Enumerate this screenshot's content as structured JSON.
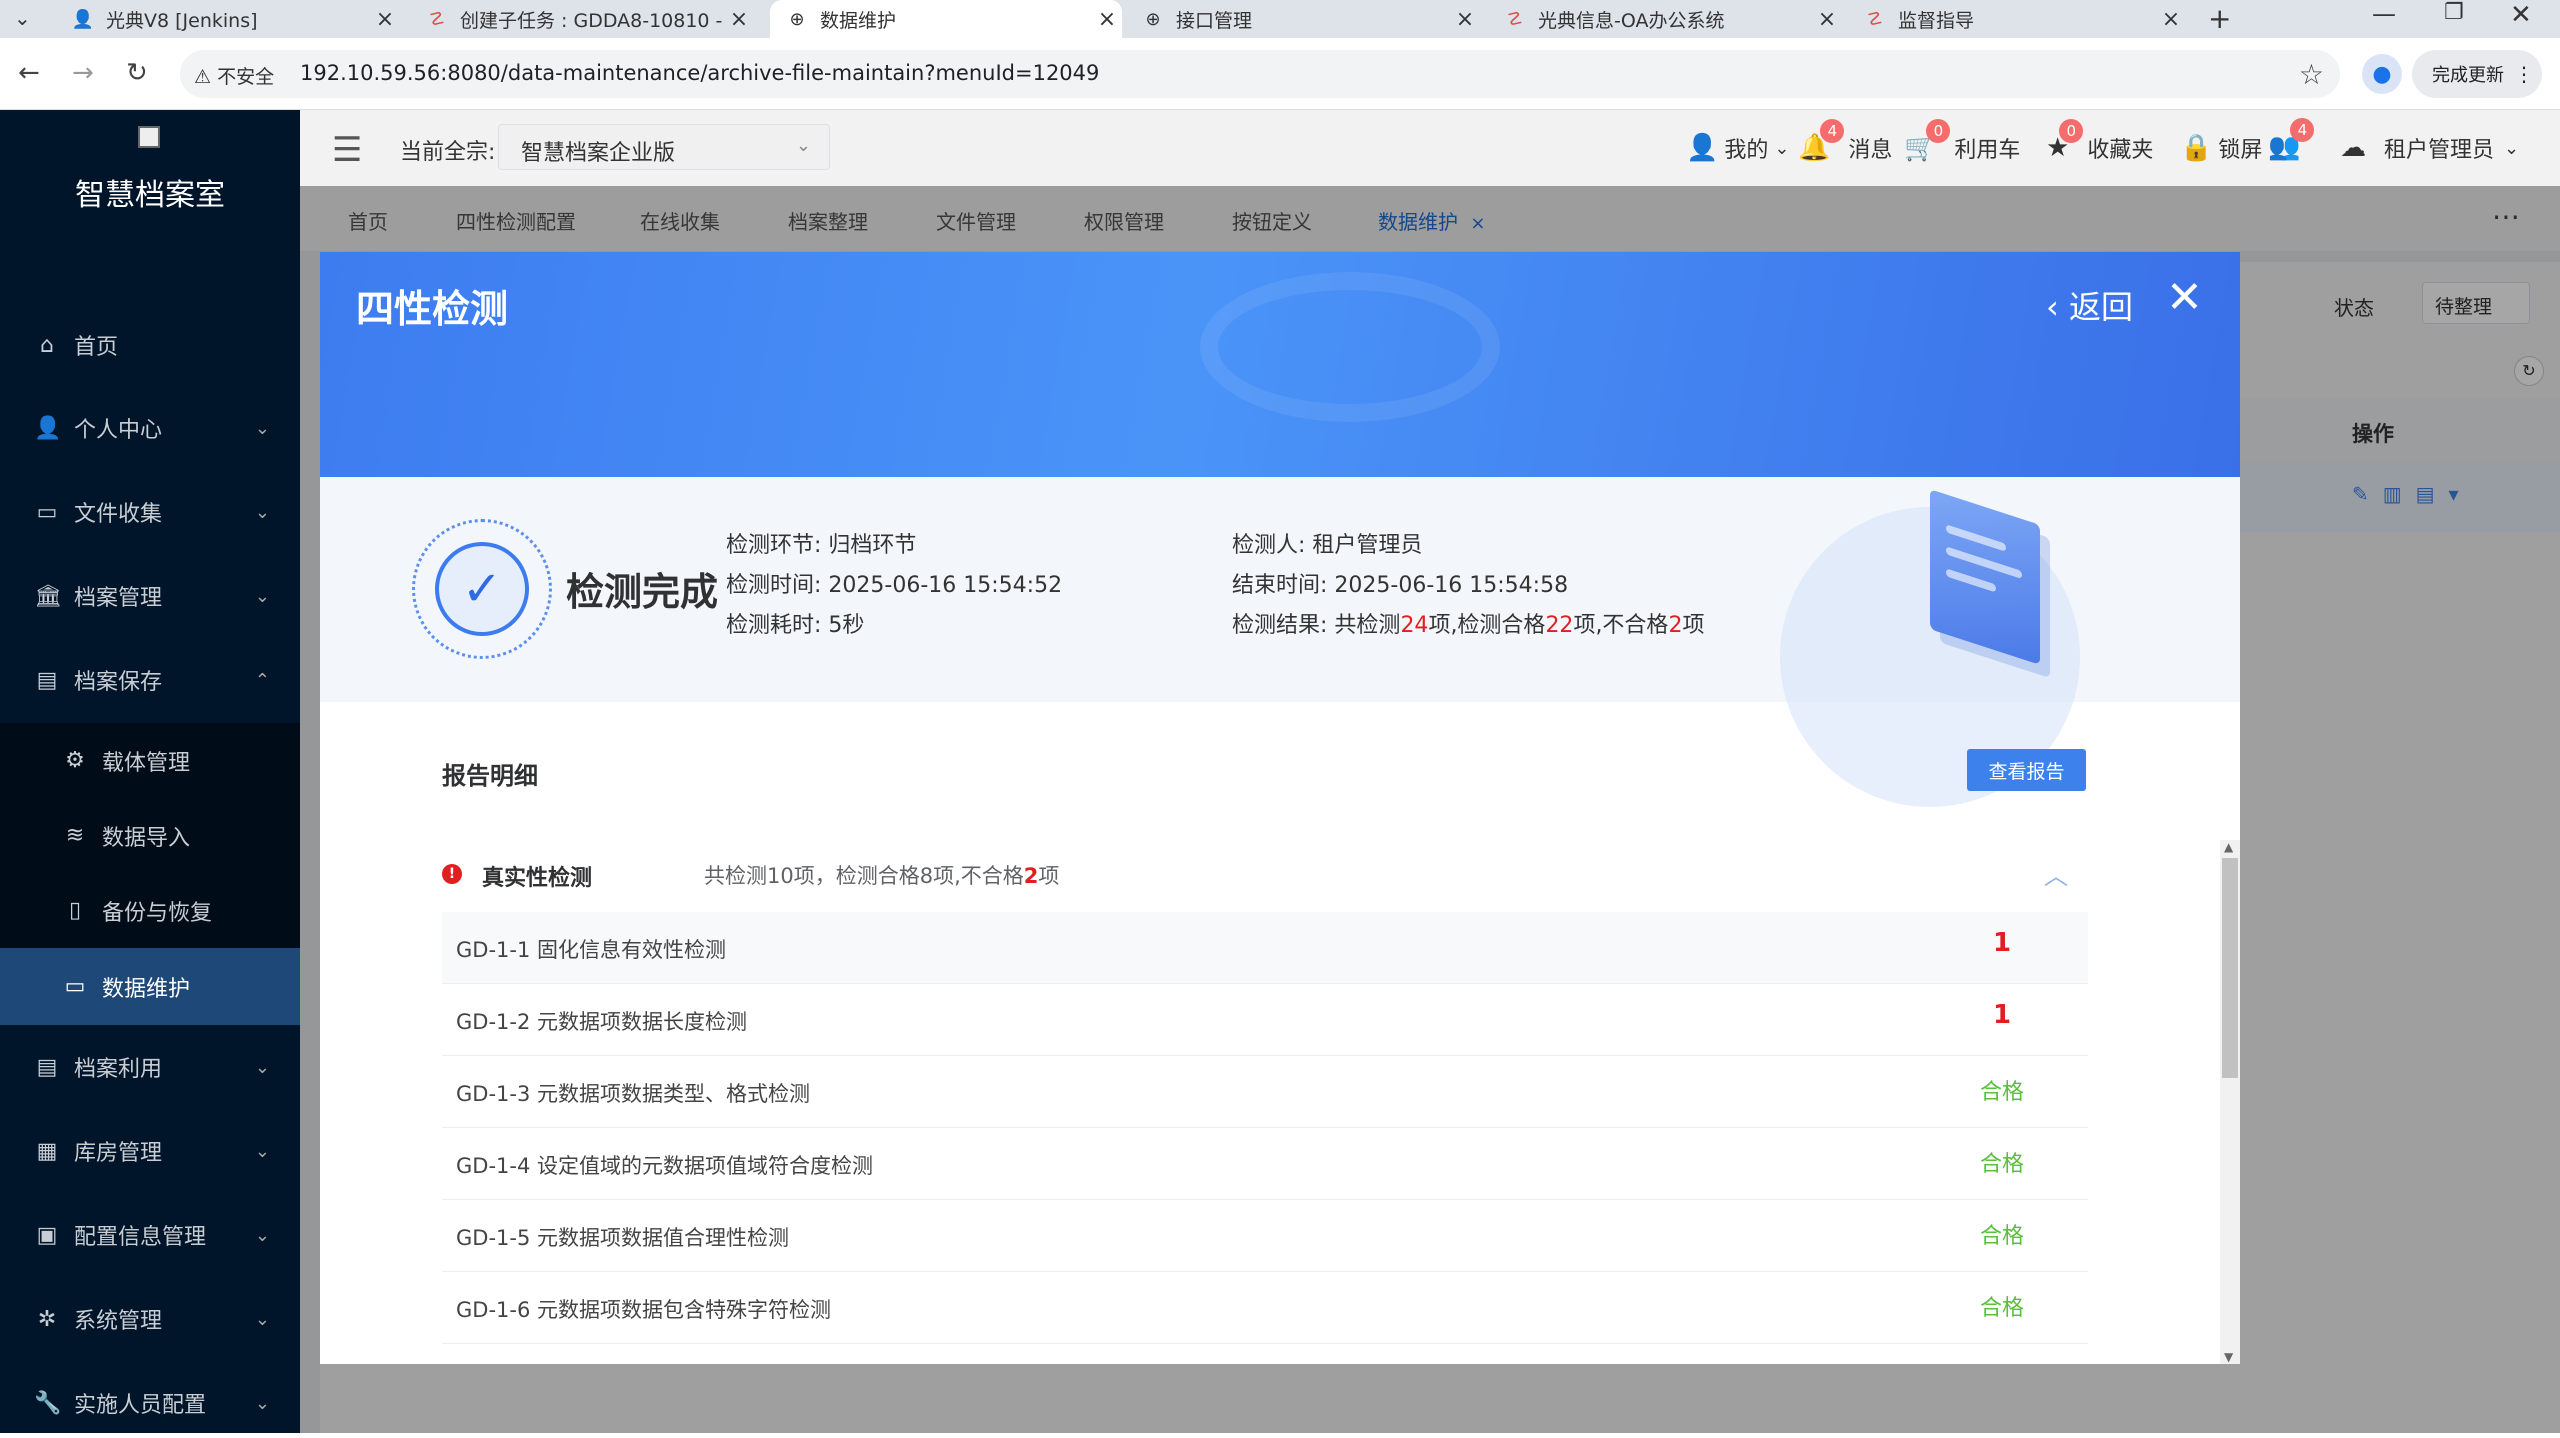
{
  "browser": {
    "tabs": [
      {
        "title": "光典V8 [Jenkins]",
        "icon": "jenkins-icon"
      },
      {
        "title": "创建子任务 : GDDA8-10810 -",
        "icon": "jira-icon"
      },
      {
        "title": "数据维护",
        "icon": "globe-icon"
      },
      {
        "title": "接口管理",
        "icon": "globe-icon"
      },
      {
        "title": "光典信息-OA办公系统",
        "icon": "oa-icon"
      },
      {
        "title": "监督指导",
        "icon": "oa-icon"
      }
    ],
    "security_label": "不安全",
    "url": "192.10.59.56:8080/data-maintenance/archive-file-maintain?menuId=12049",
    "update_label": "完成更新"
  },
  "sidebar": {
    "logo_text": "智慧档案室",
    "items": [
      {
        "label": "首页",
        "icon": "home-icon"
      },
      {
        "label": "个人中心",
        "icon": "user-icon"
      },
      {
        "label": "文件收集",
        "icon": "briefcase-icon"
      },
      {
        "label": "档案管理",
        "icon": "bank-icon"
      },
      {
        "label": "档案保存",
        "icon": "archive-box-icon"
      },
      {
        "label": "载体管理",
        "icon": "chip-icon"
      },
      {
        "label": "数据导入",
        "icon": "database-icon"
      },
      {
        "label": "备份与恢复",
        "icon": "backup-icon"
      },
      {
        "label": "数据维护",
        "icon": "folder-icon"
      },
      {
        "label": "档案利用",
        "icon": "archive-box-icon"
      },
      {
        "label": "库房管理",
        "icon": "building-icon"
      },
      {
        "label": "配置信息管理",
        "icon": "config-icon"
      },
      {
        "label": "系统管理",
        "icon": "gear-icon"
      },
      {
        "label": "实施人员配置",
        "icon": "wrench-icon"
      }
    ]
  },
  "header": {
    "current_label": "当前全宗:",
    "current_value": "智慧档案企业版",
    "mine": "我的",
    "messages": "消息",
    "messages_count": "4",
    "cart": "利用车",
    "cart_count": "0",
    "favorites": "收藏夹",
    "favorites_count": "0",
    "lock": "锁屏",
    "user_count": "4",
    "tenant": "租户管理员"
  },
  "navtabs": [
    "首页",
    "四性检测配置",
    "在线收集",
    "档案整理",
    "文件管理",
    "权限管理",
    "按钮定义",
    "数据维护"
  ],
  "modal": {
    "title": "四性检测",
    "back_label": "返回",
    "status": "检测完成",
    "stage_label": "检测环节:",
    "stage_value": "归档环节",
    "start_label": "检测时间:",
    "start_value": "2025-06-16 15:54:52",
    "duration_label": "检测耗时:",
    "duration_value": "5秒",
    "inspector_label": "检测人:",
    "inspector_value": "租户管理员",
    "end_label": "结束时间:",
    "end_value": "2025-06-16 15:54:58",
    "result_label": "检测结果:",
    "result_p1": "共检测",
    "result_total": "24",
    "result_p2": "项,检测合格",
    "result_pass": "22",
    "result_p3": "项,不合格",
    "result_fail": "2",
    "result_p4": "项",
    "report_title": "报告明细",
    "report_button": "查看报告",
    "section": {
      "title": "真实性检测",
      "summary_p1": "共检测10项，检测合格8项,不合格",
      "summary_fail": "2",
      "summary_p2": "项"
    },
    "rows": [
      {
        "name": "GD-1-1 固化信息有效性检测",
        "result": "1"
      },
      {
        "name": "GD-1-2 元数据项数据长度检测",
        "result": "1"
      },
      {
        "name": "GD-1-3 元数据项数据类型、格式检测",
        "result": "合格"
      },
      {
        "name": "GD-1-4 设定值域的元数据项值域符合度检测",
        "result": "合格"
      },
      {
        "name": "GD-1-5 元数据项数据值合理性检测",
        "result": "合格"
      },
      {
        "name": "GD-1-6 元数据项数据包含特殊字符检测",
        "result": "合格"
      }
    ]
  },
  "background": {
    "status_label": "状态",
    "status_value": "待整理",
    "col_ops": "操作"
  }
}
